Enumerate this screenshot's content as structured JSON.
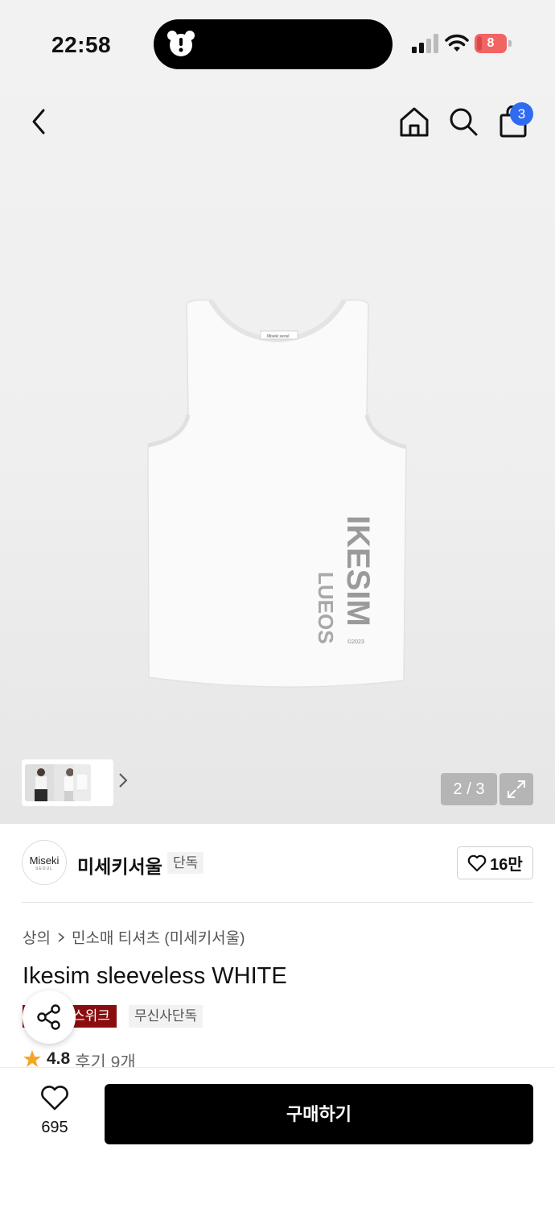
{
  "status_bar": {
    "time": "22:58",
    "battery": "8"
  },
  "header": {
    "cart_count": "3"
  },
  "gallery": {
    "counter": "2 / 3"
  },
  "brand": {
    "logo_text": "Miseki",
    "logo_sub": "SEOUL",
    "name": "미세키서울",
    "tag": "단독",
    "likes": "16만"
  },
  "product": {
    "breadcrumb": [
      "상의",
      "민소매 티셔츠 (미세키서울)"
    ],
    "title": "Ikesim sleeveless WHITE",
    "tags": [
      "스위크",
      "무신사단독"
    ],
    "rating": "4.8",
    "reviews": "후기 9개"
  },
  "bottom": {
    "wish_count": "695",
    "buy_label": "구매하기"
  },
  "colors": {
    "accent_badge": "#2f6bf0",
    "tag_red": "#8b0e0e",
    "buy_button": "#000000"
  },
  "icons": [
    "back-icon",
    "home-icon",
    "search-icon",
    "bag-icon",
    "chevron-right-icon",
    "expand-icon",
    "heart-icon",
    "share-icon",
    "star-icon"
  ]
}
